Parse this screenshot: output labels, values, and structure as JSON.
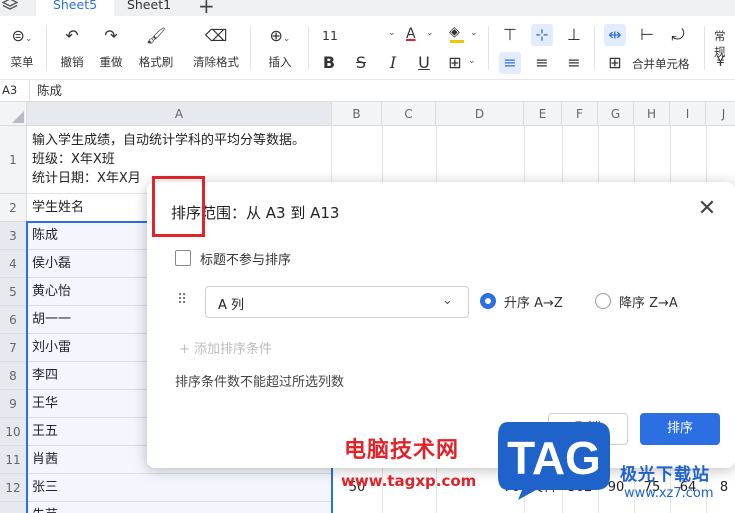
{
  "tabs": {
    "sheet_active": "Sheet5",
    "sheet_other": "Sheet1",
    "add": "+"
  },
  "toolbar": {
    "menu_label": "菜单",
    "undo_label": "撤销",
    "redo_label": "重做",
    "format_painter_label": "格式刷",
    "clear_format_label": "清除格式",
    "insert_label": "插入",
    "font_size": "11",
    "font_color_letter": "A",
    "bold": "B",
    "strike": "S",
    "italic": "I",
    "underline": "U",
    "merge_label": "合并单元格",
    "number_format": "常规",
    "currency": "¥"
  },
  "formula_bar": {
    "cell_ref": "A3",
    "content": "陈成"
  },
  "grid": {
    "columns": [
      "A",
      "B",
      "C",
      "D",
      "E",
      "F",
      "G",
      "H",
      "I",
      "J"
    ],
    "rows": [
      "1",
      "2",
      "3",
      "4",
      "5",
      "6",
      "7",
      "8",
      "9",
      "10",
      "11",
      "12"
    ],
    "a1_lines": [
      "输入学生成绩，自动统计学科的平均分等数据。",
      "班级：X年X班",
      "统计日期：X年X月"
    ],
    "a2": "学生姓名",
    "names": [
      "陈成",
      "侯小磊",
      "黄心怡",
      "胡一一",
      "刘小雷",
      "李四",
      "王华",
      "王五",
      "肖茜",
      "张三",
      "朱芸"
    ],
    "row12_values": [
      "50",
      "64",
      "70",
      "文科",
      "302",
      "90",
      "75",
      "64",
      "8"
    ]
  },
  "dialog": {
    "title": "排序范围：从 A3 到 A13",
    "header_checkbox_label": "标题不参与排序",
    "column_select_value": "A 列",
    "asc_label": "升序 A→Z",
    "desc_label": "降序 Z→A",
    "add_condition": "+ 添加排序条件",
    "limit_note": "排序条件数不能超过所选列数",
    "cancel": "取消",
    "sort": "排序"
  },
  "watermark": {
    "cn_text": "电脑技术网",
    "url": "www.tagxp.com",
    "tag": "TAG",
    "jg_text": "极光下载站",
    "jg_url": "www.xz7.com"
  },
  "colors": {
    "accent": "#2b6fe3",
    "highlight_red": "#e0242b"
  }
}
